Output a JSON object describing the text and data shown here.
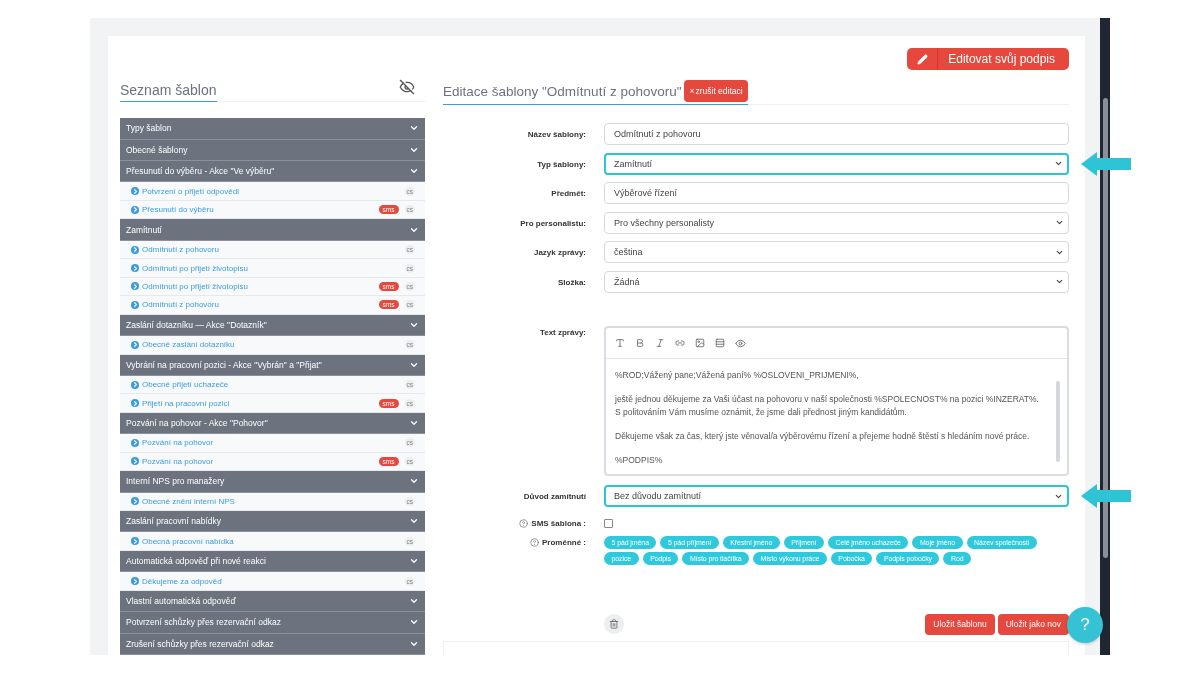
{
  "signature_button": "Editovat svůj podpis",
  "template_list": {
    "title": "Seznam šablon",
    "groups": [
      {
        "label": "Typy šablon"
      },
      {
        "label": "Obecné šablony"
      },
      {
        "label": "Přesunutí do výběru - Akce \"Ve výběru\"",
        "items": [
          {
            "label": "Potvrzení o přijetí odpovědi",
            "language": "cs"
          },
          {
            "label": "Přesunutí do výběru",
            "sms": "sms",
            "language": "cs"
          }
        ]
      },
      {
        "label": "Zamítnutí",
        "items": [
          {
            "label": "Odmítnutí z pohovoru",
            "language": "cs"
          },
          {
            "label": "Odmítnutí po přijetí životopisu",
            "language": "cs"
          },
          {
            "label": "Odmítnutí po přijetí životopisu",
            "sms": "sms",
            "language": "cs"
          },
          {
            "label": "Odmítnutí z pohovoru",
            "sms": "sms",
            "language": "cs"
          }
        ]
      },
      {
        "label": "Zaslání dotazníku — Akce \"Dotazník\"",
        "items": [
          {
            "label": "Obecné zaslání dotazníku",
            "language": "cs"
          }
        ]
      },
      {
        "label": "Vybrání na pracovní pozici - Akce \"Vybrán\" a \"Přijat\"",
        "items": [
          {
            "label": "Obecné přijetí uchazeče",
            "language": "cs"
          },
          {
            "label": "Přijetí na pracovní pozici",
            "sms": "sms",
            "language": "cs"
          }
        ]
      },
      {
        "label": "Pozvání na pohovor - Akce \"Pohovor\"",
        "items": [
          {
            "label": "Pozvání na pohovor",
            "language": "cs"
          },
          {
            "label": "Pozvání na pohovor",
            "sms": "sms",
            "language": "cs"
          }
        ]
      },
      {
        "label": "Interní NPS pro manažery",
        "items": [
          {
            "label": "Obecné znění interní NPS",
            "language": "cs"
          }
        ]
      },
      {
        "label": "Zaslání pracovní nabídky",
        "items": [
          {
            "label": "Obecná pracovní nabídka",
            "language": "cs"
          }
        ]
      },
      {
        "label": "Automatická odpověď při nové reakci",
        "items": [
          {
            "label": "Děkujeme za odpověď",
            "language": "cs"
          }
        ]
      },
      {
        "label": "Vlastní automatická odpověď"
      },
      {
        "label": "Potvrzení schůzky přes rezervační odkaz"
      },
      {
        "label": "Zrušení schůzky přes rezervační odkaz"
      }
    ]
  },
  "editor": {
    "title": "Editace šablony \"Odmítnutí z pohovoru\"",
    "cancel_icon": "×",
    "cancel_button": "zrušit editaci",
    "fields": [
      {
        "kind": "input",
        "label": "Název šablony:",
        "value": "Odmítnutí z pohovoru",
        "highlighted": false
      },
      {
        "kind": "select",
        "label": "Typ šablony:",
        "value": "Zamítnutí",
        "highlighted": true
      },
      {
        "kind": "input",
        "label": "Předmět:",
        "value": "Výběrové řízení",
        "highlighted": false
      },
      {
        "kind": "select",
        "label": "Pro personalistu:",
        "value": "Pro všechny personalisty",
        "highlighted": false
      },
      {
        "kind": "select",
        "label": "Jazyk zprávy:",
        "value": "čeština",
        "highlighted": false
      },
      {
        "kind": "select",
        "label": "Složka:",
        "value": "Žádná",
        "highlighted": false
      }
    ],
    "message": {
      "label": "Text zprávy:",
      "paragraphs": [
        [
          "%ROD;Vážený pane;Vážená paní% %OSLOVENI_PRIJMENI%,"
        ],
        [
          "ještě jednou děkujeme za Vaši účast na pohovoru v naší společnosti %SPOLECNOST% na pozici %INZERAT%.",
          "S politováním Vám musíme oznámit, že jsme dali přednost jiným kandidátům."
        ],
        [
          "Děkujeme však za čas, který jste věnoval/a výběrovému řízení a přejeme hodně štěstí s hledáním nové práce."
        ],
        [
          "%PODPIS%"
        ]
      ]
    },
    "reason": {
      "kind": "select",
      "label": "Důvod zamítnutí",
      "value": "Bez důvodu zamítnutí",
      "highlighted": true
    },
    "sms_template": {
      "label": "SMS šablona :",
      "checked": false
    },
    "variables": {
      "label": "Proměnné :",
      "tags": [
        "5 pád jména",
        "5 pád příjmení",
        "Křestní jméno",
        "Příjmení",
        "Celé jméno uchazeče",
        "Moje jméno",
        "Název společnosti",
        "pozice",
        "Podpis",
        "Místo pro tlačítka",
        "Místo výkonu práce",
        "Pobočka",
        "Podpis pobočky",
        "Rod"
      ]
    },
    "buttons": [
      "Uložit šablonu",
      "Uložit jako nov"
    ],
    "help_button": "?"
  }
}
